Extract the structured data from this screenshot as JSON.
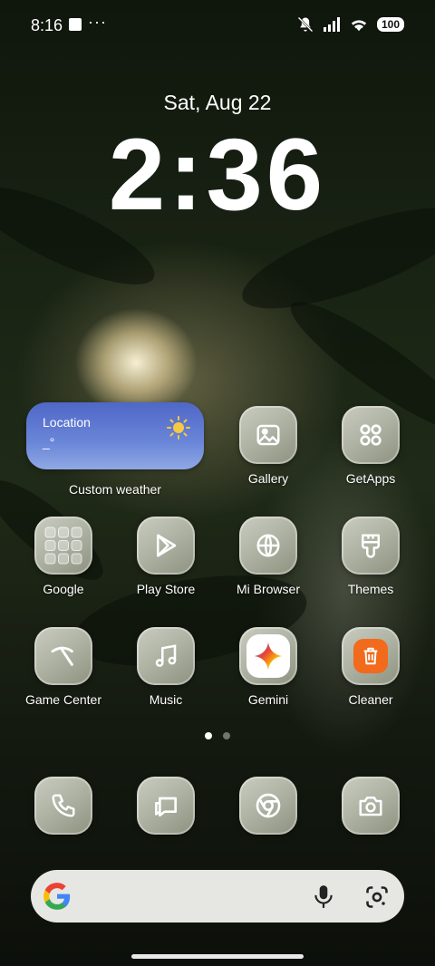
{
  "status": {
    "time": "8:16",
    "dots": "···",
    "battery": "100"
  },
  "lock": {
    "date": "Sat, Aug 22",
    "clock": "2:36"
  },
  "weather": {
    "location": "Location",
    "temp": "_°",
    "label": "Custom weather"
  },
  "apps": {
    "gallery": "Gallery",
    "getapps": "GetApps",
    "google": "Google",
    "playstore": "Play Store",
    "browser": "Mi Browser",
    "themes": "Themes",
    "gamecenter": "Game Center",
    "music": "Music",
    "gemini": "Gemini",
    "cleaner": "Cleaner"
  },
  "dock": {
    "phone": "Phone",
    "messages": "Messages",
    "chrome": "Chrome",
    "camera": "Camera"
  },
  "colors": {
    "weather_top": "#4f67c7",
    "cleaner_accent": "#f26a1b",
    "icon_glyph": "#ffffff"
  }
}
